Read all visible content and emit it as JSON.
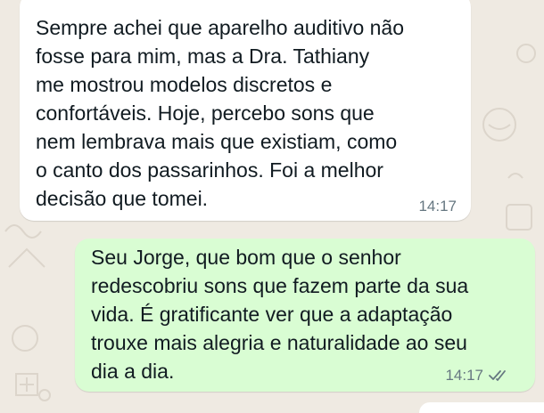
{
  "chat": {
    "incoming": {
      "text": "Sempre achei que aparelho auditivo não\nfosse para mim, mas a Dra. Tathiany\nme mostrou modelos discretos e\nconfortáveis. Hoje, percebo sons que\nnem lembrava mais que existiam, como\no canto dos passarinhos. Foi a melhor\ndecisão que tomei.",
      "time": "14:17"
    },
    "outgoing": {
      "text": "Seu Jorge, que bom que o senhor\nredescobriu sons que fazem parte da sua\nvida. É gratificante ver que a adaptação\ntrouxe mais alegria e naturalidade ao seu\ndia a dia.",
      "time": "14:17",
      "status_icon": "double-check-read-icon"
    }
  },
  "colors": {
    "wallpaper": "#efeae2",
    "incoming_bubble": "#ffffff",
    "outgoing_bubble": "#d9fdd3",
    "timestamp": "#667781",
    "text": "#111b21"
  }
}
